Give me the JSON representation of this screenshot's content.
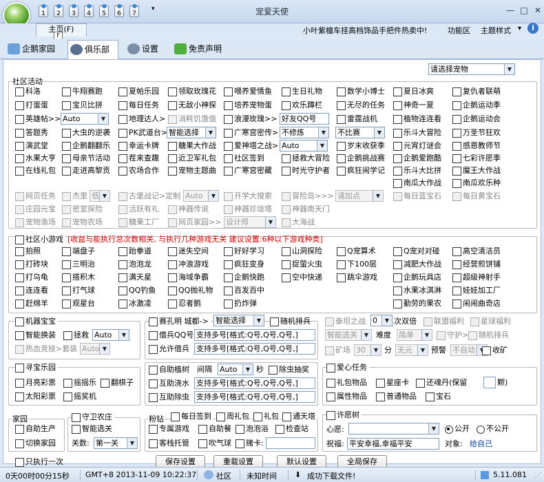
{
  "window": {
    "title": "宠爱天使",
    "quick_nums": [
      "1",
      "2",
      "3",
      "4",
      "5",
      "6",
      "7"
    ]
  },
  "menu": {
    "home": "主页(F)",
    "home_key": "F",
    "ad": "小叶紫檀车挂高档饰品手把件热卖中!",
    "function": "功能区",
    "theme": "主题样式"
  },
  "tabs": [
    "企鹅家园",
    "俱乐部",
    "设置",
    "免责声明"
  ],
  "pet_select": "请选择宠物",
  "community": {
    "legend": "社区活动",
    "r1": [
      "科洛",
      "牛翔赛跑",
      "夏帕乐园",
      "领取玫瑰花",
      "喂养爱情鱼",
      "生日礼物",
      "数学小博士",
      "夏日冰爽",
      "复仇者联萌"
    ],
    "r2": [
      "打蛋蛋",
      "宝贝比拼",
      "每日任务",
      "无敌小神探",
      "培养宠物蛋",
      "欢乐蹲栏",
      "无尽的任务",
      "神奇一夏",
      "企鹅运动季"
    ],
    "r3_a": "英雄帖>>",
    "r3_a_sel": "Auto",
    "r3_b": "地理达人>",
    "r3_c": "消耗饥饿值",
    "r3_d": "浪漫玫瑰>>",
    "r3_d_inp": "好友QQ号",
    "r3_e": "雷霆战机",
    "r3_f": "植物连连看",
    "r3_g": "企鹅运动会",
    "r4_a": "答题秀",
    "r4_b": "大虫的逆袭",
    "r4_c": "PK武道台>",
    "r4_c_sel": "智能选择",
    "r4_d": "广寒宫密传>",
    "r4_d_sel": "不修炼",
    "r4_d_sel2": "不比赛",
    "r4_e": "乐斗大冒险",
    "r4_f": "万圣节狂欢",
    "r5": [
      "演武堂",
      "企鹅翻翻乐",
      "幸运卡牌",
      "糖果大作战",
      "爱神塔之战>",
      "岁末收获季",
      "元宵灯谜会",
      "感恩教师节"
    ],
    "r5_sel": "Auto",
    "r6": [
      "水果大亨",
      "母亲节活动",
      "茬来查趣",
      "近卫军礼包",
      "社区签到",
      "拯救大冒险",
      "企鹅挑战赛",
      "企鹅爱跑酷",
      "七彩许愿季"
    ],
    "r7": [
      "在线礼包",
      "走进高黎贡",
      "农场合作",
      "宠物主题曲",
      "广寒宫密藏",
      "时光守护者",
      "疯狂闹学记",
      "乐斗大比拼",
      "魔王大作战"
    ],
    "r8": [
      "南瓜大作战",
      "南瓜欢乐种"
    ],
    "d1": [
      "网页任务",
      "杰里",
      "古堡战记>定制",
      "开学大搜索",
      "冒险岛>>>",
      "每日蓝宝石",
      "每日黄宝石"
    ],
    "d1_sel1": "低",
    "d1_sel2": "Auto",
    "d1_inp": "请加点",
    "d2": [
      "庄园元宝",
      "密室探险",
      "活跃有礼",
      "神器传说",
      "神器珍珑塔",
      "神器南天门"
    ],
    "d3": [
      "宠物渔场",
      "宠物农场",
      "糖果工厂",
      "网页家园>>",
      "大海战"
    ],
    "d3_sel": "设计师"
  },
  "minigames": {
    "label": "社区小游戏",
    "note": "[收益与能执行总次数相关, 与执行几种游戏无关 建议设置:6种以下游戏种类]",
    "rows": [
      [
        "拍照",
        "端盘子",
        "跆拳道",
        "迷失空间",
        "好好学习",
        "山洞探险",
        "Q宠算术",
        "Q宠对对碰",
        "高空清洁员"
      ],
      [
        "打砖块",
        "三明治",
        "泡泡龙",
        "冲浪游戏",
        "疯狂变身",
        "捉萤火虫",
        "下100层",
        "减肥大作战",
        "经营煎饼铺"
      ],
      [
        "打乌龟",
        "搭积木",
        "满天星",
        "海域争霸",
        "企鹅快跑",
        "空中快递",
        "跳伞游戏",
        "企鹅玩具店",
        "超级神射手"
      ],
      [
        "连连看",
        "打气球",
        "QQ钓鱼",
        "QQ抛礼物",
        "百发百中"
      ],
      [
        "赶绵羊",
        "观星台",
        "冰激凌",
        "忍者鹅",
        "扔炸弹"
      ]
    ],
    "r4_extra": [
      "水果冰淇淋",
      "娃娃加工厂"
    ],
    "r5_extra": [
      "勤劳的果农",
      "闹闹曲奇店"
    ]
  },
  "machine": {
    "legend": "机器宝宝",
    "smart_swap": "智能换装",
    "tuo": "拯救",
    "tuo_sel": "Auto",
    "hot": "热血竞技>套装",
    "hot_sel": "Auto"
  },
  "race": {
    "legend": "赛孔明 城都->",
    "sel": "智能选择",
    "random": "随机排兵",
    "borrow": "借兵QQ号",
    "borrow_inp": "支持多号[格式:Q号,Q号,Q号,]",
    "allow": "允许借兵",
    "allow_inp": "支持多号[格式:Q号,Q号,Q号,]"
  },
  "taishan": {
    "lbl": "泰坦之战",
    "sel": "0",
    "times": "次双倍",
    "alliance": "联盟福利",
    "star": "星球福利",
    "sel_smart": "智能选关",
    "difficulty": "难度",
    "diff_sel": "简单",
    "guard": "守护>",
    "random": "随机排兵",
    "mine": "矿场",
    "mine_sel": "30",
    "fen": "分",
    "none_sel": "无元",
    "warn": "预警",
    "auto_sel": "不自动",
    "harvest": "收矿"
  },
  "treasure": {
    "legend": "寻宝乐园",
    "a": "月亮彩票",
    "b": "摇摇乐",
    "c": "翻棋子",
    "d": "太阳彩票",
    "e": "摇奖机"
  },
  "plant": {
    "a": "自助植树",
    "interval": "间隔",
    "sel": "Auto",
    "sec": "秒",
    "weed": "除虫抽奖",
    "water": "互助浇水",
    "water_inp": "支持多号[格式:Q号,Q号,Q号,]",
    "bug": "互助除虫",
    "bug_inp": "支持多号[格式:Q号,Q号,Q号,]"
  },
  "love": {
    "legend": "爱心任务",
    "a": "礼包物品",
    "b": "星座卡",
    "c": "还魂丹(保留",
    "c_end": "颗)",
    "d": "属性物品",
    "e": "普通物品",
    "f": "宝石"
  },
  "home": {
    "legend": "家园",
    "a": "自助生产",
    "b": "切换家园"
  },
  "farm": {
    "legend": "守卫农庄",
    "a": "智能选关",
    "level": "关数:",
    "sel": "第一关"
  },
  "fendian": {
    "legend": "粉钻",
    "a": "每日签到",
    "b": "周礼包",
    "c": "礼包",
    "d": "通天塔",
    "e": "专属游戏",
    "f": "自助餐",
    "g": "泡泡浴",
    "h": "检查站",
    "i": "客栈托管",
    "j": "吹气球",
    "k": "赌卡:"
  },
  "wish": {
    "legend": "许愿树",
    "heart": "心愿:",
    "public": "公开",
    "private": "不公开",
    "bless": "祝福:",
    "bless_inp": "平安幸福,幸福平安",
    "target": "对象:",
    "target_val": "给自己"
  },
  "bottom": {
    "only_once": "只执行一次",
    "save": "保存设置",
    "reload": "重载设置",
    "default": "默认设置",
    "all_save": "全局保存"
  },
  "status": {
    "time": "0天00时00分15秒",
    "clock": "GMT+8 2013-11-09 10:22:37",
    "community": "社区",
    "unknown": "未知时间",
    "download": "成功下载文件!",
    "version": "5.11.081"
  },
  "colors": {
    "accent": "#003fa0",
    "warn": "#cc0000"
  }
}
